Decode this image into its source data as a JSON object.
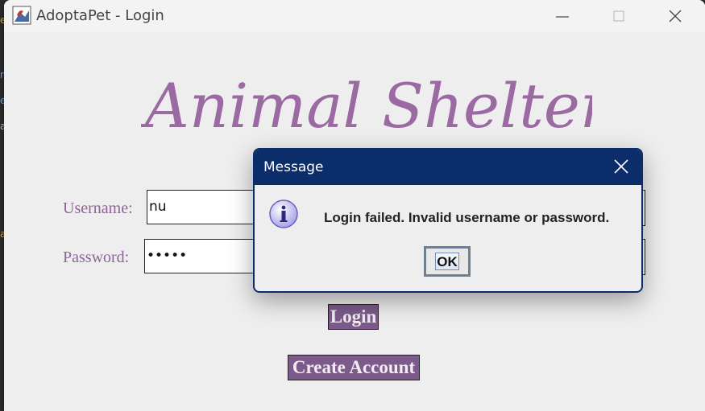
{
  "window": {
    "title": "AdoptaPet - Login"
  },
  "header": {
    "hero_text": "Animal Shelter",
    "hero_color": "#9b6aa3"
  },
  "form": {
    "username_label": "Username:",
    "username_value": "nu",
    "password_label": "Password:",
    "password_value": "•••••",
    "login_label": "Login",
    "create_account_label": "Create Account"
  },
  "dialog": {
    "title": "Message",
    "message": "Login failed. Invalid username or password.",
    "ok_label": "OK",
    "icon": "info-icon"
  },
  "colors": {
    "accent": "#7c5a8a",
    "label": "#8e6399",
    "dialog_header": "#0b2d6a"
  }
}
